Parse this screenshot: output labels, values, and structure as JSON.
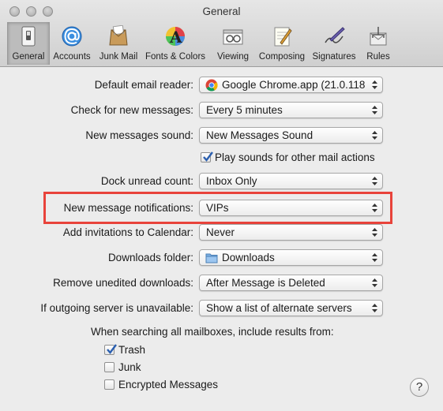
{
  "window": {
    "title": "General"
  },
  "toolbar": {
    "items": [
      {
        "label": "General",
        "icon": "general-switch-icon"
      },
      {
        "label": "Accounts",
        "icon": "at-sign-icon"
      },
      {
        "label": "Junk Mail",
        "icon": "junk-mail-icon"
      },
      {
        "label": "Fonts & Colors",
        "icon": "fonts-colors-icon"
      },
      {
        "label": "Viewing",
        "icon": "viewing-icon"
      },
      {
        "label": "Composing",
        "icon": "composing-icon"
      },
      {
        "label": "Signatures",
        "icon": "signatures-icon"
      },
      {
        "label": "Rules",
        "icon": "rules-icon"
      }
    ]
  },
  "settings": {
    "default_reader": {
      "label": "Default email reader:",
      "value": "Google Chrome.app (21.0.118"
    },
    "check_messages": {
      "label": "Check for new messages:",
      "value": "Every 5 minutes"
    },
    "new_sound": {
      "label": "New messages sound:",
      "value": "New Messages Sound"
    },
    "play_sounds": {
      "label": "Play sounds for other mail actions",
      "checked": true
    },
    "dock_unread": {
      "label": "Dock unread count:",
      "value": "Inbox Only"
    },
    "notifications": {
      "label": "New message notifications:",
      "value": "VIPs"
    },
    "invitations": {
      "label": "Add invitations to Calendar:",
      "value": "Never"
    },
    "downloads_folder": {
      "label": "Downloads folder:",
      "value": "Downloads"
    },
    "remove_downloads": {
      "label": "Remove unedited downloads:",
      "value": "After Message is Deleted"
    },
    "outgoing_server": {
      "label": "If outgoing server is unavailable:",
      "value": "Show a list of alternate servers"
    },
    "search_heading": "When searching all mailboxes, include results from:",
    "search_trash": {
      "label": "Trash",
      "checked": true
    },
    "search_junk": {
      "label": "Junk",
      "checked": false
    },
    "search_encrypted": {
      "label": "Encrypted Messages",
      "checked": false
    }
  },
  "help": {
    "label": "?"
  },
  "colors": {
    "highlight": "#e8433b",
    "check": "#2a5fb0"
  }
}
